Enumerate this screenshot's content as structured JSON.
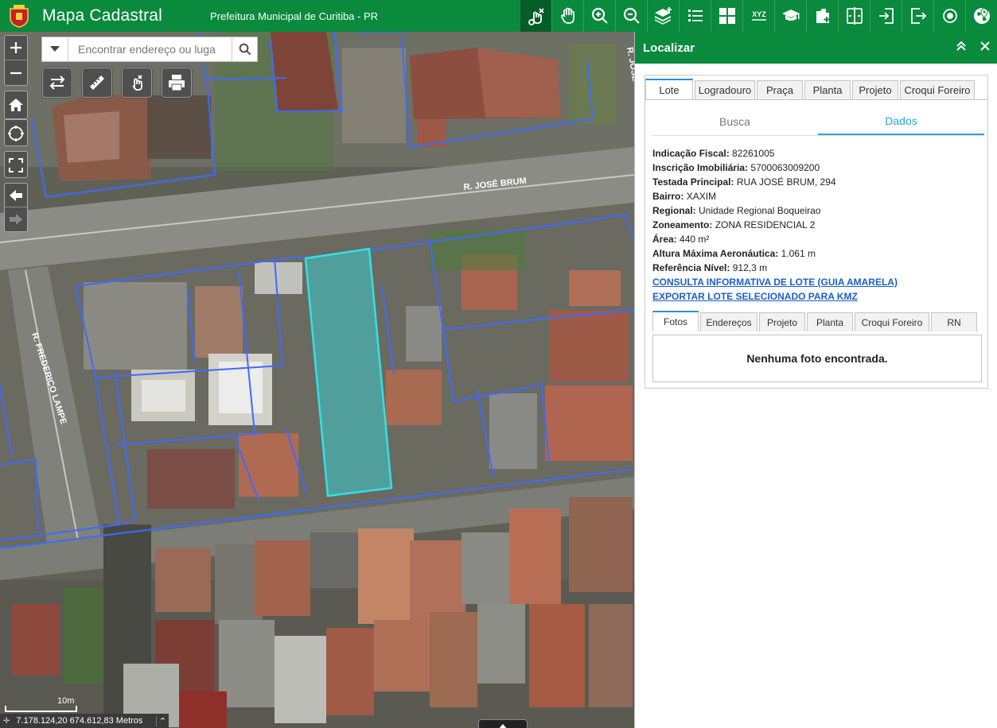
{
  "header": {
    "title": "Mapa Cadastral",
    "subtitle": "Prefeitura Municipal de Curitiba - PR",
    "tools": [
      {
        "name": "identify-tool-icon",
        "active": true
      },
      {
        "name": "pan-hand-icon"
      },
      {
        "name": "zoom-in-icon"
      },
      {
        "name": "zoom-out-icon"
      },
      {
        "name": "layers-add-icon"
      },
      {
        "name": "legend-list-icon"
      },
      {
        "name": "grid-icon"
      },
      {
        "name": "xyz-coordinates-icon",
        "label": "XYZ"
      },
      {
        "name": "graduation-cap-icon"
      },
      {
        "name": "add-document-icon"
      },
      {
        "name": "swipe-compare-icon"
      },
      {
        "name": "login-arrow-icon"
      },
      {
        "name": "logout-arrow-icon"
      },
      {
        "name": "target-icon"
      },
      {
        "name": "globe-pin-icon"
      }
    ]
  },
  "search": {
    "placeholder": "Encontrar endereço ou luga"
  },
  "map": {
    "street_labels": [
      "R. JOSÉ BRUM",
      "R. FREDERICO LAMPE",
      "R. JOSÉ"
    ],
    "scale_label": "10m",
    "coordinates": "7.178.124,20 674.612,83 Metros",
    "selected_lot_color": "#33e0e6",
    "parcel_line_color": "#3d6bff"
  },
  "panel": {
    "title": "Localizar",
    "tabs": [
      "Lote",
      "Logradouro",
      "Praça",
      "Planta",
      "Projeto",
      "Croqui Foreiro"
    ],
    "subtabs": [
      "Busca",
      "Dados"
    ],
    "fields": [
      {
        "label": "Indicação Fiscal:",
        "value": "82261005"
      },
      {
        "label": "Inscrição Imobiliária:",
        "value": "5700063009200"
      },
      {
        "label": "Testada Principal:",
        "value": "RUA JOSÉ BRUM, 294"
      },
      {
        "label": "Bairro:",
        "value": "XAXIM"
      },
      {
        "label": "Regional:",
        "value": "Unidade Regional Boqueirao"
      },
      {
        "label": "Zoneamento:",
        "value": "ZONA RESIDENCIAL 2"
      },
      {
        "label": "Área:",
        "value": "440 m²"
      },
      {
        "label": "Altura Máxima Aeronáutica:",
        "value": "1.061 m"
      },
      {
        "label": "Referência Nível:",
        "value": "912,3 m"
      }
    ],
    "links": [
      "CONSULTA INFORMATIVA DE LOTE (GUIA AMARELA)",
      "EXPORTAR LOTE SELECIONADO PARA KMZ"
    ],
    "bottom_tabs": [
      "Fotos",
      "Endereços",
      "Projeto",
      "Planta",
      "Croqui Foreiro",
      "RN"
    ],
    "empty_message": "Nenhuma foto encontrada."
  }
}
